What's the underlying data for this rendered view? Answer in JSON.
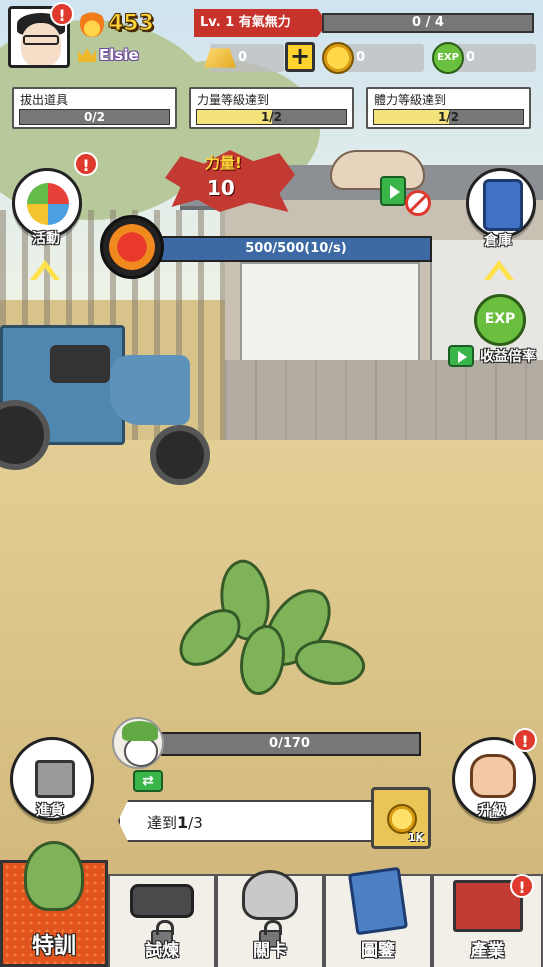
{
  "player": {
    "fire_count": "453",
    "username": "Elsie",
    "level_label": "Lv. 1 有氣無力",
    "level_progress": "0 / 4",
    "level_progress_fraction": 0
  },
  "resources": {
    "gold_bar": "0",
    "coins": "0",
    "exp": "0"
  },
  "quests": [
    {
      "label": "拔出道具",
      "progress": "0/2",
      "fraction": 0
    },
    {
      "label": "力量等級達到",
      "progress": "1/2",
      "fraction": 0.5
    },
    {
      "label": "體力等級達到",
      "progress": "1/2",
      "fraction": 0.5
    }
  ],
  "power": {
    "label": "力量!",
    "value": "10"
  },
  "energy": {
    "text": "500/500(10/s)",
    "fraction": 1
  },
  "side_buttons": {
    "event": "活動",
    "storage": "倉庫",
    "boost": "收益倍率",
    "exp_badge": "EXP",
    "restock": "進貨",
    "upgrade": "升級"
  },
  "alerts": {
    "mark": "!"
  },
  "growth": {
    "text": "0/170",
    "fraction": 0
  },
  "goal": {
    "prefix": "達到",
    "current": "1",
    "total": "/3",
    "reward": "1K"
  },
  "nav": [
    {
      "label": "特訓",
      "active": true,
      "locked": false
    },
    {
      "label": "試煉",
      "active": false,
      "locked": true
    },
    {
      "label": "關卡",
      "active": false,
      "locked": true
    },
    {
      "label": "圖鑒",
      "active": false,
      "locked": false
    },
    {
      "label": "產業",
      "active": false,
      "locked": false
    }
  ],
  "colors": {
    "accent_red": "#c7332b",
    "energy_blue": "#3d6aa5",
    "button_green": "#39b54a",
    "active_tab": "#e2541e"
  }
}
